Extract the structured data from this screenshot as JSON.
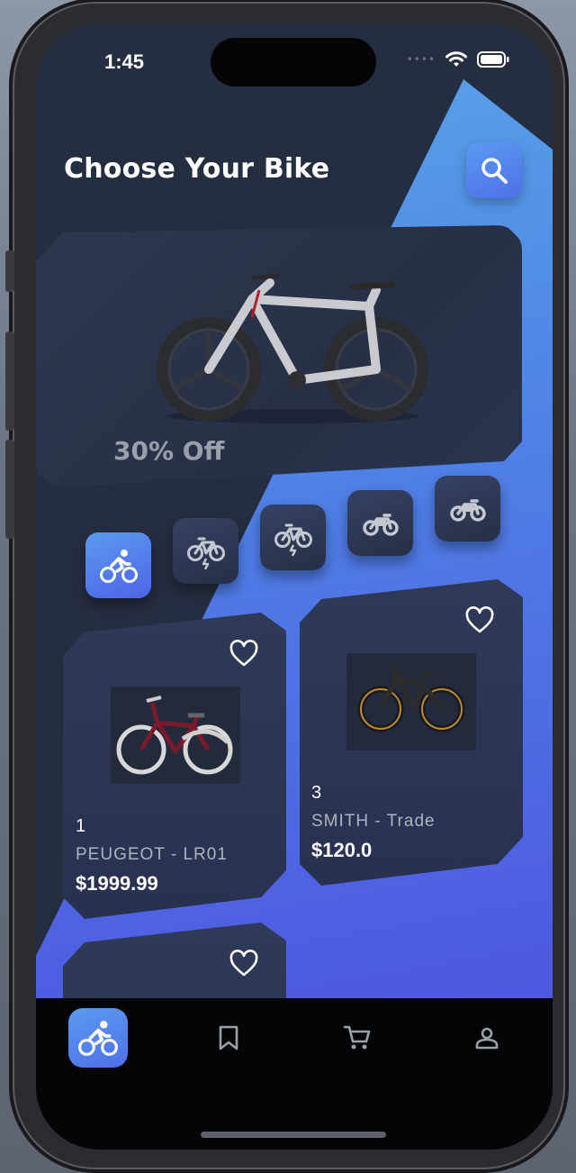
{
  "status_bar": {
    "time": "1:45"
  },
  "header": {
    "title": "Choose Your Bike"
  },
  "hero": {
    "discount": "30% Off"
  },
  "categories": [
    {
      "name": "bicycle",
      "icon": "cyclist-icon",
      "active": true
    },
    {
      "name": "e-bike",
      "icon": "electric-bike-icon",
      "active": false
    },
    {
      "name": "e-bike-2",
      "icon": "electric-bike-icon",
      "active": false
    },
    {
      "name": "motorbike",
      "icon": "motorbike-icon",
      "active": false
    },
    {
      "name": "motorbike-2",
      "icon": "motorbike-icon",
      "active": false
    }
  ],
  "products": [
    {
      "number": "1",
      "name": "PEUGEOT - LR01",
      "price": "$1999.99"
    },
    {
      "number": "3",
      "name": "SMITH - Trade",
      "price": "$120.0"
    }
  ],
  "tabbar": {
    "items": [
      {
        "name": "bikes",
        "icon": "cyclist-icon",
        "active": true
      },
      {
        "name": "saved",
        "icon": "bookmark-icon",
        "active": false
      },
      {
        "name": "cart",
        "icon": "cart-icon",
        "active": false
      },
      {
        "name": "profile",
        "icon": "person-icon",
        "active": false
      }
    ]
  },
  "colors": {
    "accent": "#4f82e6",
    "background": "#252d40",
    "card": "#2f3a58"
  }
}
